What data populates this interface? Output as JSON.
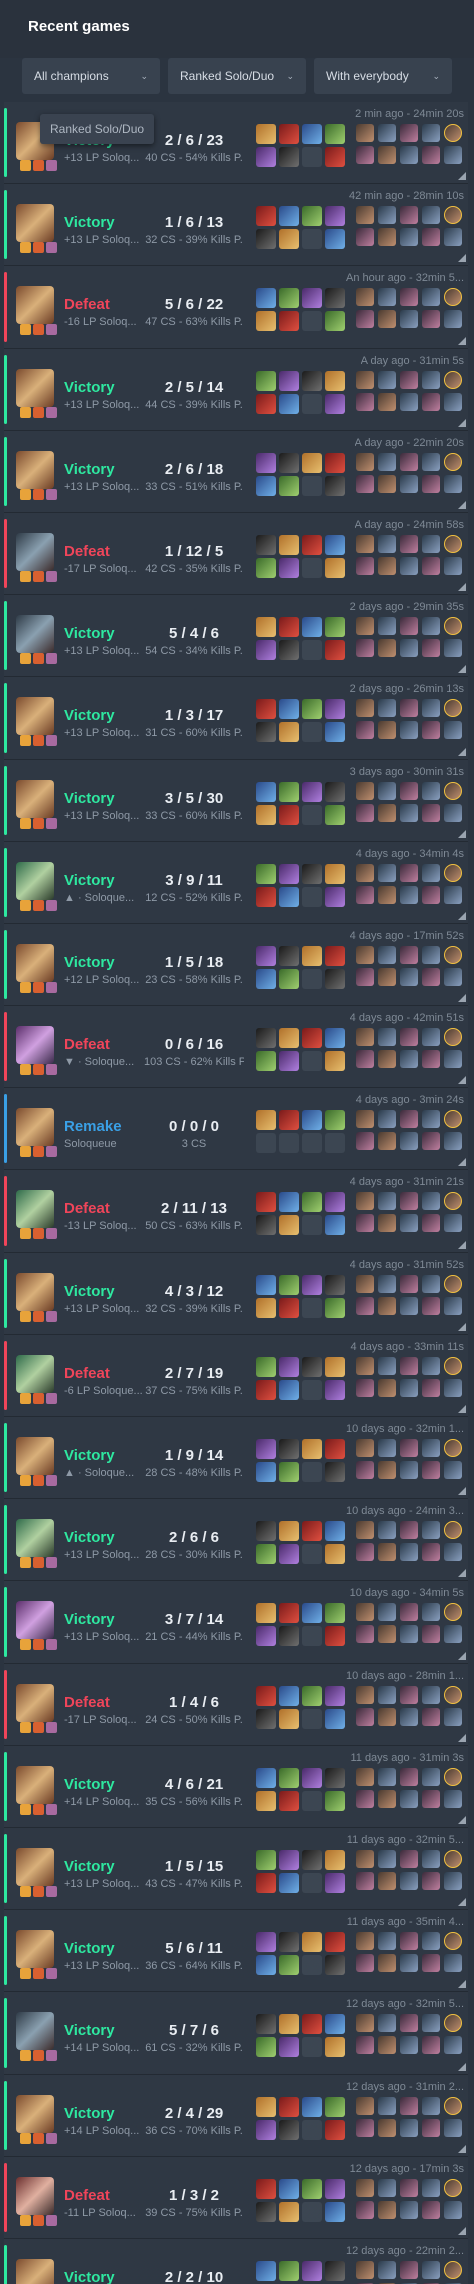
{
  "header": {
    "title": "Recent games"
  },
  "filters": [
    {
      "label": "All champions"
    },
    {
      "label": "Ranked Solo/Duo"
    },
    {
      "label": "With everybody"
    }
  ],
  "tooltip": {
    "text": "Ranked Solo/Duo"
  },
  "games": [
    {
      "result": "Victory",
      "lp": "+13 LP Soloq...",
      "kda": "2 / 6 / 23",
      "stats": "40 CS - 54% Kills P.",
      "time": "2 min ago - 24min 20s",
      "type": "victory",
      "champ": "c1"
    },
    {
      "result": "Victory",
      "lp": "+13 LP Soloq...",
      "kda": "1 / 6 / 13",
      "stats": "32 CS - 39% Kills P.",
      "time": "42 min ago - 28min 10s",
      "type": "victory",
      "champ": "c1"
    },
    {
      "result": "Defeat",
      "lp": "-16 LP Soloq...",
      "kda": "5 / 6 / 22",
      "stats": "47 CS - 63% Kills P.",
      "time": "An hour ago - 32min 5...",
      "type": "defeat",
      "champ": "c1"
    },
    {
      "result": "Victory",
      "lp": "+13 LP Soloq...",
      "kda": "2 / 5 / 14",
      "stats": "44 CS - 39% Kills P.",
      "time": "A day ago - 31min 5s",
      "type": "victory",
      "champ": "c1"
    },
    {
      "result": "Victory",
      "lp": "+13 LP Soloq...",
      "kda": "2 / 6 / 18",
      "stats": "33 CS - 51% Kills P.",
      "time": "A day ago - 22min 20s",
      "type": "victory",
      "champ": "c1"
    },
    {
      "result": "Defeat",
      "lp": "-17 LP Soloq...",
      "kda": "1 / 12 / 5",
      "stats": "42 CS - 35% Kills P.",
      "time": "A day ago - 24min 58s",
      "type": "defeat",
      "champ": "c2"
    },
    {
      "result": "Victory",
      "lp": "+13 LP Soloq...",
      "kda": "5 / 4 / 6",
      "stats": "54 CS - 34% Kills P.",
      "time": "2 days ago - 29min 35s",
      "type": "victory",
      "champ": "c2"
    },
    {
      "result": "Victory",
      "lp": "+13 LP Soloq...",
      "kda": "1 / 3 / 17",
      "stats": "31 CS - 60% Kills P.",
      "time": "2 days ago - 26min 13s",
      "type": "victory",
      "champ": "c1"
    },
    {
      "result": "Victory",
      "lp": "+13 LP Soloq...",
      "kda": "3 / 5 / 30",
      "stats": "33 CS - 60% Kills P.",
      "time": "3 days ago - 30min 31s",
      "type": "victory",
      "champ": "c1"
    },
    {
      "result": "Victory",
      "lp": "▲ · Soloque...",
      "kda": "3 / 9 / 11",
      "stats": "12 CS - 52% Kills P.",
      "time": "4 days ago - 34min 4s",
      "type": "victory",
      "champ": "c3"
    },
    {
      "result": "Victory",
      "lp": "+12 LP Soloq...",
      "kda": "1 / 5 / 18",
      "stats": "23 CS - 58% Kills P.",
      "time": "4 days ago - 17min 52s",
      "type": "victory",
      "champ": "c1"
    },
    {
      "result": "Defeat",
      "lp": "▼ · Soloque...",
      "kda": "0 / 6 / 16",
      "stats": "103 CS - 62% Kills P.",
      "time": "4 days ago - 42min 51s",
      "type": "defeat",
      "champ": "c4"
    },
    {
      "result": "Remake",
      "lp": "Soloqueue",
      "kda": "0 / 0 / 0",
      "stats": "3 CS",
      "time": "4 days ago - 3min 24s",
      "type": "remake",
      "champ": "c1"
    },
    {
      "result": "Defeat",
      "lp": "-13 LP Soloq...",
      "kda": "2 / 11 / 13",
      "stats": "50 CS - 63% Kills P.",
      "time": "4 days ago - 31min 21s",
      "type": "defeat",
      "champ": "c3"
    },
    {
      "result": "Victory",
      "lp": "+13 LP Soloq...",
      "kda": "4 / 3 / 12",
      "stats": "32 CS - 39% Kills P.",
      "time": "4 days ago - 31min 52s",
      "type": "victory",
      "champ": "c1"
    },
    {
      "result": "Defeat",
      "lp": "-6 LP Soloque...",
      "kda": "2 / 7 / 19",
      "stats": "37 CS - 75% Kills P.",
      "time": "4 days ago - 33min 11s",
      "type": "defeat",
      "champ": "c3"
    },
    {
      "result": "Victory",
      "lp": "▲ · Soloque...",
      "kda": "1 / 9 / 14",
      "stats": "28 CS - 48% Kills P.",
      "time": "10 days ago - 32min 1...",
      "type": "victory",
      "champ": "c1"
    },
    {
      "result": "Victory",
      "lp": "+13 LP Soloq...",
      "kda": "2 / 6 / 6",
      "stats": "28 CS - 30% Kills P.",
      "time": "10 days ago - 24min 3...",
      "type": "victory",
      "champ": "c3"
    },
    {
      "result": "Victory",
      "lp": "+13 LP Soloq...",
      "kda": "3 / 7 / 14",
      "stats": "21 CS - 44% Kills P.",
      "time": "10 days ago - 34min 5s",
      "type": "victory",
      "champ": "c4"
    },
    {
      "result": "Defeat",
      "lp": "-17 LP Soloq...",
      "kda": "1 / 4 / 6",
      "stats": "24 CS - 50% Kills P.",
      "time": "10 days ago - 28min 1...",
      "type": "defeat",
      "champ": "c1"
    },
    {
      "result": "Victory",
      "lp": "+14 LP Soloq...",
      "kda": "4 / 6 / 21",
      "stats": "35 CS - 56% Kills P.",
      "time": "11 days ago - 31min 3s",
      "type": "victory",
      "champ": "c1"
    },
    {
      "result": "Victory",
      "lp": "+13 LP Soloq...",
      "kda": "1 / 5 / 15",
      "stats": "43 CS - 47% Kills P.",
      "time": "11 days ago - 32min 5...",
      "type": "victory",
      "champ": "c1"
    },
    {
      "result": "Victory",
      "lp": "+13 LP Soloq...",
      "kda": "5 / 6 / 11",
      "stats": "36 CS - 64% Kills P.",
      "time": "11 days ago - 35min 4...",
      "type": "victory",
      "champ": "c1"
    },
    {
      "result": "Victory",
      "lp": "+14 LP Soloq...",
      "kda": "5 / 7 / 6",
      "stats": "61 CS - 32% Kills P.",
      "time": "12 days ago - 32min 5...",
      "type": "victory",
      "champ": "c2"
    },
    {
      "result": "Victory",
      "lp": "+14 LP Soloq...",
      "kda": "2 / 4 / 29",
      "stats": "36 CS - 70% Kills P.",
      "time": "12 days ago - 31min 2...",
      "type": "victory",
      "champ": "c1"
    },
    {
      "result": "Defeat",
      "lp": "-11 LP Soloq...",
      "kda": "1 / 3 / 2",
      "stats": "39 CS - 75% Kills P.",
      "time": "12 days ago - 17min 3s",
      "type": "defeat",
      "champ": "c5"
    },
    {
      "result": "Victory",
      "lp": "+14 LP Soloq...",
      "kda": "2 / 2 / 10",
      "stats": "30 CS - 59% Kills P.",
      "time": "12 days ago - 22min 2...",
      "type": "victory",
      "champ": "c1"
    }
  ]
}
